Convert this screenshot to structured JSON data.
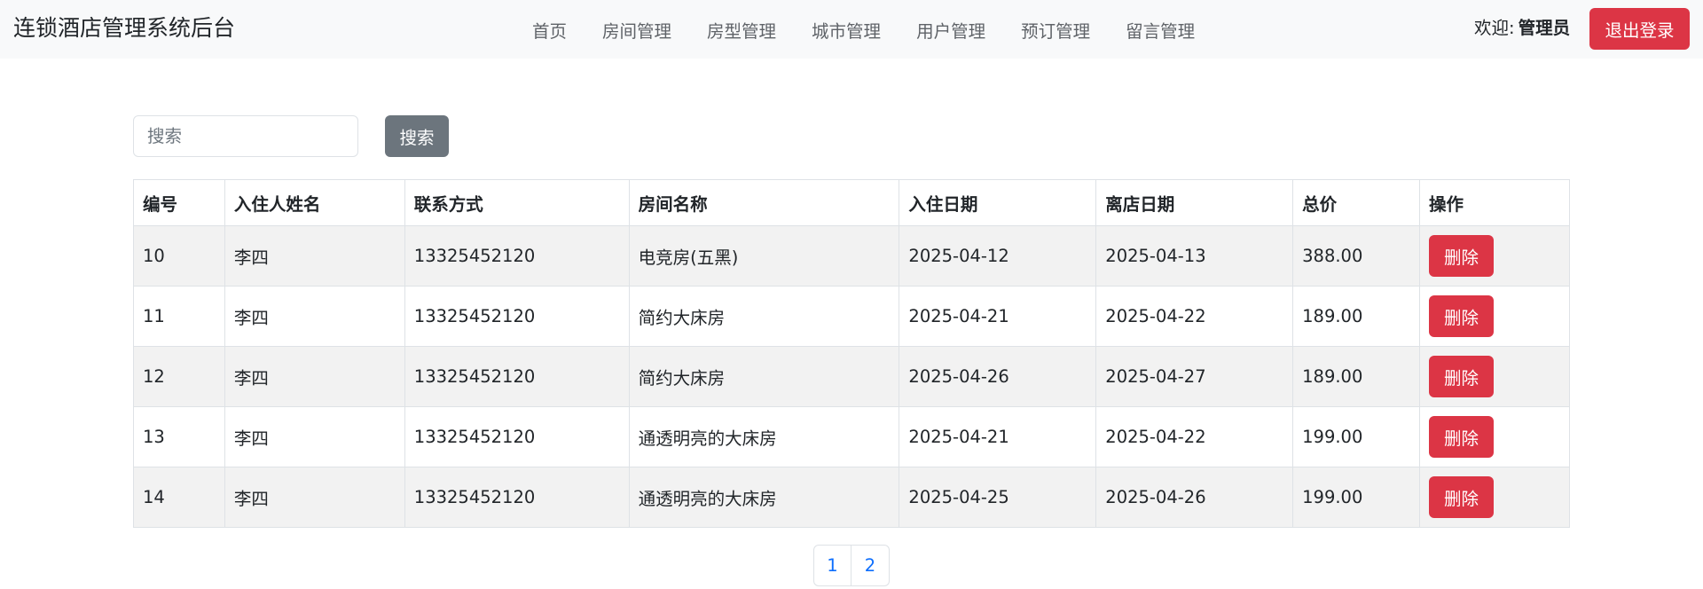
{
  "navbar": {
    "brand": "连锁酒店管理系统后台",
    "links": [
      "首页",
      "房间管理",
      "房型管理",
      "城市管理",
      "用户管理",
      "预订管理",
      "留言管理"
    ],
    "welcome_label": "欢迎:",
    "username": "管理员",
    "logout_label": "退出登录"
  },
  "search": {
    "placeholder": "搜索",
    "button_label": "搜索"
  },
  "table": {
    "headers": [
      "编号",
      "入住人姓名",
      "联系方式",
      "房间名称",
      "入住日期",
      "离店日期",
      "总价",
      "操作"
    ],
    "delete_label": "删除",
    "rows": [
      {
        "id": "10",
        "name": "李四",
        "phone": "13325452120",
        "room": "电竞房(五黑)",
        "checkin": "2025-04-12",
        "checkout": "2025-04-13",
        "total": "388.00"
      },
      {
        "id": "11",
        "name": "李四",
        "phone": "13325452120",
        "room": "简约大床房",
        "checkin": "2025-04-21",
        "checkout": "2025-04-22",
        "total": "189.00"
      },
      {
        "id": "12",
        "name": "李四",
        "phone": "13325452120",
        "room": "简约大床房",
        "checkin": "2025-04-26",
        "checkout": "2025-04-27",
        "total": "189.00"
      },
      {
        "id": "13",
        "name": "李四",
        "phone": "13325452120",
        "room": "通透明亮的大床房",
        "checkin": "2025-04-21",
        "checkout": "2025-04-22",
        "total": "199.00"
      },
      {
        "id": "14",
        "name": "李四",
        "phone": "13325452120",
        "room": "通透明亮的大床房",
        "checkin": "2025-04-25",
        "checkout": "2025-04-26",
        "total": "199.00"
      }
    ]
  },
  "pagination": {
    "pages": [
      "1",
      "2"
    ]
  },
  "colors": {
    "danger": "#dc3545",
    "secondary": "#6c757d",
    "link": "#0d6efd",
    "navbar_bg": "#f8f9fa",
    "stripe": "#f2f2f2"
  }
}
